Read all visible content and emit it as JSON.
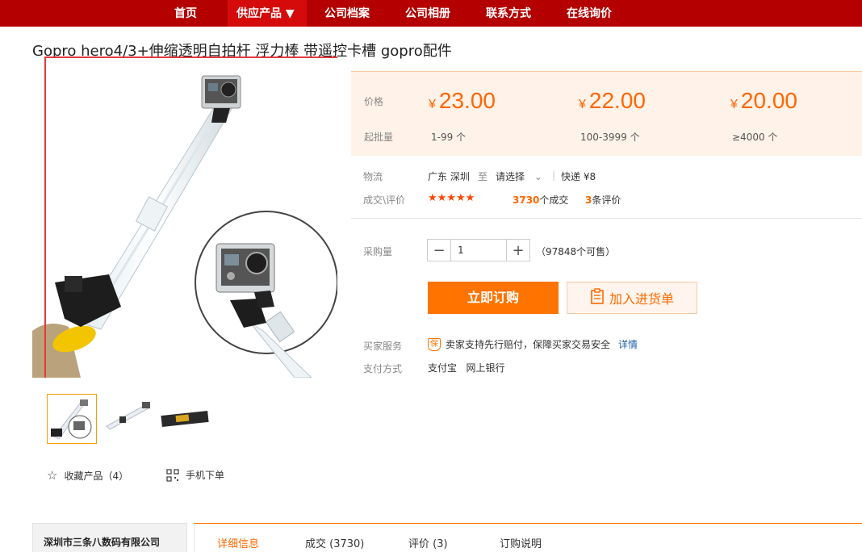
{
  "nav": {
    "items": [
      "首页",
      "供应产品 ▼",
      "公司档案",
      "公司相册",
      "联系方式",
      "在线询价"
    ]
  },
  "product": {
    "title": "Gopro hero4/3+伸缩透明自拍杆 浮力棒 带遥控卡槽 gopro配件"
  },
  "price_panel": {
    "price_label": "价格",
    "moq_label": "起批量",
    "currency": "¥",
    "tiers": [
      {
        "price": "23.00",
        "range": "1-99 个"
      },
      {
        "price": "22.00",
        "range": "100-3999 个"
      },
      {
        "price": "20.00",
        "range": "≥4000 个"
      }
    ]
  },
  "logistics": {
    "label": "物流",
    "from": "广东 深圳",
    "to_word": "至",
    "select": "请选择",
    "express": "快递 ¥8"
  },
  "deals": {
    "label": "成交\\评价",
    "stars": "★★★★★",
    "deal_count": "3730",
    "deal_suffix": "个成交",
    "review_count": "3",
    "review_suffix": "条评价"
  },
  "purchase": {
    "label": "采购量",
    "minus": "−",
    "value": "1",
    "plus": "+",
    "stock": "（97848个可售）",
    "buy_now": "立即订购",
    "add_cart": "加入进货单"
  },
  "service": {
    "label": "买家服务",
    "badge": "保",
    "text": "卖家支持先行赔付，保障买家交易安全",
    "link": "详情"
  },
  "payment": {
    "label": "支付方式",
    "methods": "支付宝   网上银行"
  },
  "actions": {
    "favorite": "收藏产品（4）",
    "mobile": "手机下单"
  },
  "shop": {
    "name": "深圳市三条八数码有限公司"
  },
  "tabs": [
    "详细信息",
    "成交 (3730)",
    "评价 (3)",
    "订购说明"
  ],
  "colors": {
    "nav_bg": "#b40000",
    "accent": "#ff6600",
    "buy_btn": "#ff7300",
    "price_bg": "#fff2e8"
  }
}
